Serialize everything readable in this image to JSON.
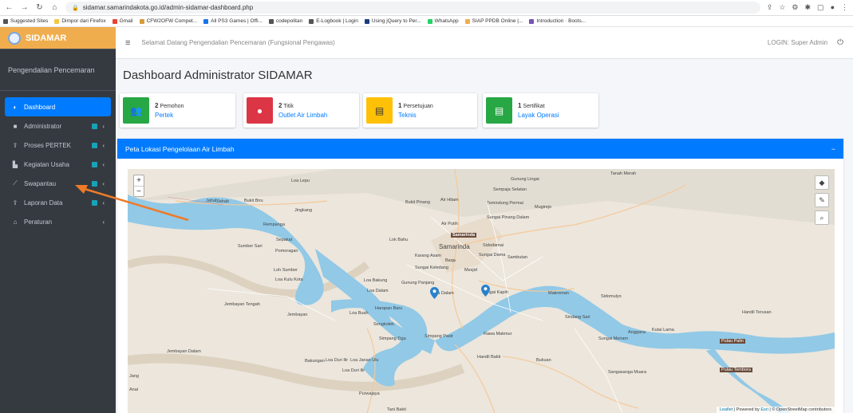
{
  "browser": {
    "url": "sidamar.samarindakota.go.id/admin-sidamar-dashboard.php",
    "bookmarks": [
      "Suggested Sites",
      "Dimpor dari Firefox",
      "Gmail",
      "CFW2OFW Compet...",
      "All PS3 Games | Offi...",
      "codepolitan",
      "E-Logbook | Login",
      "Using jQuery to Per...",
      "WhatsApp",
      "SIAP PPDB Online |...",
      "Introduction · Boots..."
    ]
  },
  "sidebar": {
    "brand": "SIDAMAR",
    "panel_title": "Pengendalian Pencemaran",
    "items": [
      {
        "label": "Dashboard",
        "active": true
      },
      {
        "label": "Administrator"
      },
      {
        "label": "Proses PERTEK"
      },
      {
        "label": "Kegiatan Usaha"
      },
      {
        "label": "Swapantau"
      },
      {
        "label": "Laporan Data"
      },
      {
        "label": "Peraturan"
      }
    ]
  },
  "topnav": {
    "welcome": "Selamat Datang Pengendalian Pencemaran (Fungsional Pengawas)",
    "login": "LOGIN: Super Admin"
  },
  "main": {
    "title": "Dashboard Administrator SIDAMAR",
    "boxes": [
      {
        "count": "2",
        "unit": "Pemohon",
        "link": "Pertek",
        "color": "#28a745"
      },
      {
        "count": "2",
        "unit": "Titik",
        "link": "Outlet Air Limbah",
        "color": "#dc3545"
      },
      {
        "count": "1",
        "unit": "Persetujuan",
        "link": "Teknis",
        "color": "#ffc107"
      },
      {
        "count": "1",
        "unit": "Sertifikat",
        "link": "Layak Operasi",
        "color": "#28a745"
      }
    ],
    "map_title": "Peta Lokasi Pengelolaan Air Limbah",
    "map_collapse": "−",
    "attribution_prefix": "Leaflet",
    "attribution_mid": " | Powered by ",
    "attribution_esri": "Esri",
    "attribution_rest": " | © OpenStreetMap contributors"
  },
  "map_labels": [
    "Tanah Merah",
    "Gunung Lingai",
    "Sempaja Selatan",
    "Bukit Pinang",
    "Air Hitam",
    "Temindung Permai",
    "Mugirejo",
    "Sungai Pinang Dalam",
    "Air Putih",
    "Samarinda",
    "Samarinda",
    "Sidodamai",
    "Lok Bahu",
    "Sungai Dama",
    "Sambutan",
    "Karang Asam",
    "Baqa",
    "Sungai Keledang",
    "Mesjid",
    "Loa Bakung",
    "Gunung Panjang",
    "Sungai Kapih",
    "Makroman",
    "Sidomulyo",
    "Harapan Baru",
    "Loa Buah",
    "Sengkotek",
    "Simpang Tiga",
    "Simpang Pasir",
    "Rawa Makmur",
    "Handil Bakti",
    "Bukuan",
    "Sindang Sari",
    "Anggana",
    "Kutai Lama",
    "Sungai Meriam",
    "Pulau Palin",
    "Handil Terusan",
    "Sangasanga Muara",
    "Pulau Tembora",
    "Loa Lepu",
    "Bukit Biru",
    "Jahab",
    "Jingkang",
    "Rempanga",
    "Sepakat",
    "Sumber Sari",
    "Pomoragan",
    "Loh Sumber",
    "Loa Kulu Kota",
    "Jembayan Tengah",
    "Jembayan",
    "Jembayan Dalam",
    "Bakungan",
    "Loa Duri Ilir",
    "Loa Janan Ulu",
    "Loa Duri Ilir",
    "Purwajaya",
    "Tani Bakti",
    "Jang",
    "Anai",
    "Jahab",
    "Kota Dalam",
    "Loa Dalam"
  ]
}
